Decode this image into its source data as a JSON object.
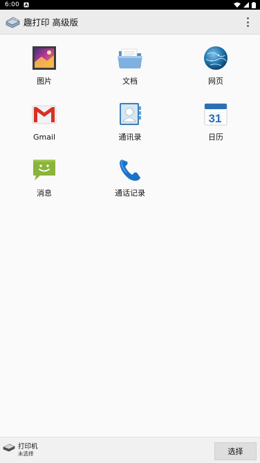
{
  "status_bar": {
    "time": "6:00",
    "notification_icon": "notification-a-icon",
    "icons": [
      "wifi-icon",
      "signal-icon",
      "battery-icon"
    ]
  },
  "header": {
    "title": "趣打印 高级版",
    "app_icon": "printer-app-icon",
    "menu_icon": "overflow-menu-icon"
  },
  "grid": {
    "items": [
      {
        "label": "图片",
        "icon": "gallery-icon"
      },
      {
        "label": "文档",
        "icon": "folder-icon"
      },
      {
        "label": "网页",
        "icon": "globe-icon"
      },
      {
        "label": "Gmail",
        "icon": "gmail-icon"
      },
      {
        "label": "通讯录",
        "icon": "contacts-icon"
      },
      {
        "label": "日历",
        "icon": "calendar-icon"
      },
      {
        "label": "消息",
        "icon": "messages-icon"
      },
      {
        "label": "通话记录",
        "icon": "phone-icon"
      }
    ],
    "calendar_day": "31"
  },
  "bottom_bar": {
    "printer_title": "打印机",
    "printer_status": "未选择",
    "select_label": "选择"
  },
  "colors": {
    "status_bar": "#000000",
    "action_bar": "#ececec",
    "background": "#fafafa",
    "gmail_red": "#d93025",
    "messages_green": "#8ab43a",
    "phone_blue": "#1a73c8",
    "globe_blue": "#1c6fa8"
  }
}
